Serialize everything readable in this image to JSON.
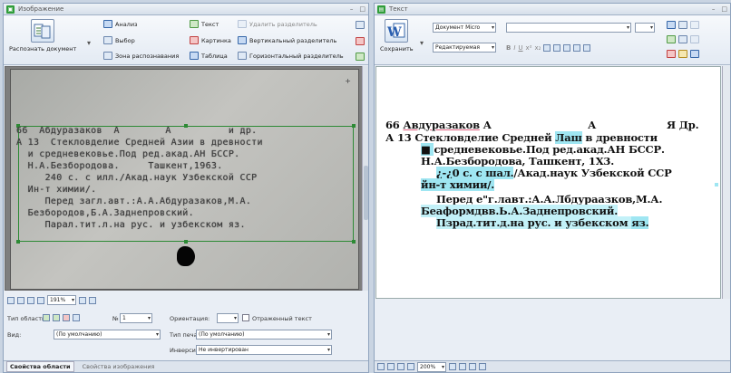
{
  "left_pane": {
    "title": "Изображение",
    "win_controls": [
      "–",
      "□"
    ],
    "recognize_label": "Распознать документ",
    "ribbon": {
      "analyze": "Анализ",
      "select": "Выбор",
      "text": "Текст",
      "remove_dividers": "Удалить разделитель",
      "picture": "Картинка",
      "vertical_divider": "Вертикальный разделитель",
      "recognition_zone": "Зона распознавания",
      "table": "Таблица",
      "horizontal_divider": "Горизонтальный разделитель"
    },
    "scan_lines": [
      "66  Абдуразаков  А        А          и др.",
      "А 13  Стекловделие Средней Азии в древности",
      "  и средневековье.Под ред.акад.АН БССР.",
      "  Н.А.Безбородова.     Ташкент,1963.",
      "     240 с. с илл./Акад.наук Узбекской ССР",
      "  Ин-т химии/.",
      "     Перед загл.авт.:А.А.Абдуразаков,М.А.",
      "  Безбородов,Б.А.Заднепровский.",
      "     Парал.тит.л.на рус. и узбекском яз."
    ],
    "zoom": "191%",
    "props": {
      "area_type_label": "Тип области:",
      "no_label": "№",
      "no_value": "1",
      "orientation_label": "Ориентация:",
      "inverted_text_label": "Отраженный текст",
      "view_label": "Вид:",
      "view_value": "(По умолчанию)",
      "print_type_label": "Тип печати:",
      "print_type_value": "(По умолчанию)",
      "inversion_label": "Инверсия:",
      "inversion_value": "Не инвертирован"
    },
    "tabs": [
      "Свойства области",
      "Свойства изображения"
    ]
  },
  "right_pane": {
    "title": "Текст",
    "win_controls": [
      "–",
      "□"
    ],
    "save_label": "Сохранить",
    "document_dropdown": "Документ Micro",
    "mode_dropdown": "Редактируемая",
    "format_buttons": [
      "B",
      "I",
      "U",
      "x²",
      "x₂"
    ],
    "zoom": "200%",
    "text_lines": [
      {
        "parts": [
          {
            "t": "66 "
          },
          {
            "t": "Авдуразаков",
            "ul": true
          },
          {
            "t": "  А"
          }
        ]
      },
      {
        "parts": [
          {
            "t": "А"
          }
        ]
      },
      {
        "parts": [
          {
            "t": "Я Др."
          }
        ]
      },
      {
        "parts": [
          {
            "t": "А 13  Стекловделие Средней "
          },
          {
            "t": "Лаш",
            "hl": true
          },
          {
            "t": " в древности"
          }
        ]
      },
      {
        "parts": [
          {
            "t": "■ ",
            "hl": true
          },
          {
            "t": "средневековье.Под ред.акад.АН БССР."
          }
        ]
      },
      {
        "parts": [
          {
            "t": "Н.А.Безбородова,       Ташкент, 1Х3."
          }
        ]
      },
      {
        "parts": [
          {
            "t": "¿-¿0 с. с ",
            "hl": true
          },
          {
            "t": "шал.",
            "hl": true
          },
          {
            "t": "/Акад.наук Узбекской ССР"
          }
        ]
      },
      {
        "parts": [
          {
            "t": "йн-т химии/.",
            "hl": true
          }
        ]
      },
      {
        "parts": [
          {
            "t": "Перед е\"г.лавт.:А.А.Лбдураазков,М.А."
          }
        ]
      },
      {
        "parts": [
          {
            "t": "Беаформдвв.Ь.А.Заднепровский.",
            "hl2": true
          }
        ]
      },
      {
        "parts": [
          {
            "t": "Пзрад.тит.д.на рус. и узбекском ",
            "hl2": true
          },
          {
            "t": "яз.",
            "hl": true
          }
        ]
      }
    ]
  }
}
